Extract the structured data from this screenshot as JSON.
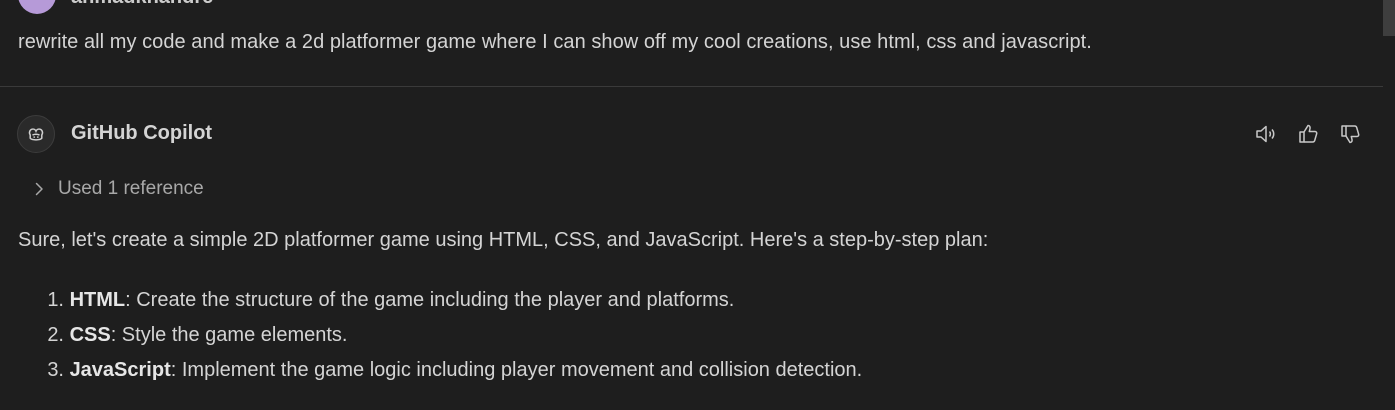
{
  "user": {
    "name": "ahmadkhandre",
    "message": "rewrite all my code and make a 2d platformer game where I can show off my cool creations, use html, css and javascript."
  },
  "assistant": {
    "name": "GitHub Copilot",
    "reference_label": "Used 1 reference",
    "intro": "Sure, let's create a simple 2D platformer game using HTML, CSS, and JavaScript. Here's a step-by-step plan:",
    "steps": [
      {
        "number": "1.",
        "title": "HTML",
        "text": ": Create the structure of the game including the player and platforms."
      },
      {
        "number": "2.",
        "title": "CSS",
        "text": ": Style the game elements."
      },
      {
        "number": "3.",
        "title": "JavaScript",
        "text": ": Implement the game logic including player movement and collision detection."
      }
    ]
  },
  "icons": {
    "user_avatar": "user-avatar",
    "copilot_avatar": "copilot-icon",
    "read_aloud": "speaker-icon",
    "thumbs_up": "thumbs-up-icon",
    "thumbs_down": "thumbs-down-icon",
    "reference_toggle": "chevron-right-icon"
  },
  "colors": {
    "background": "#1e1e1e",
    "text": "#d4d4d4",
    "muted": "#a8a8a8",
    "avatar": "#b69ad8"
  }
}
